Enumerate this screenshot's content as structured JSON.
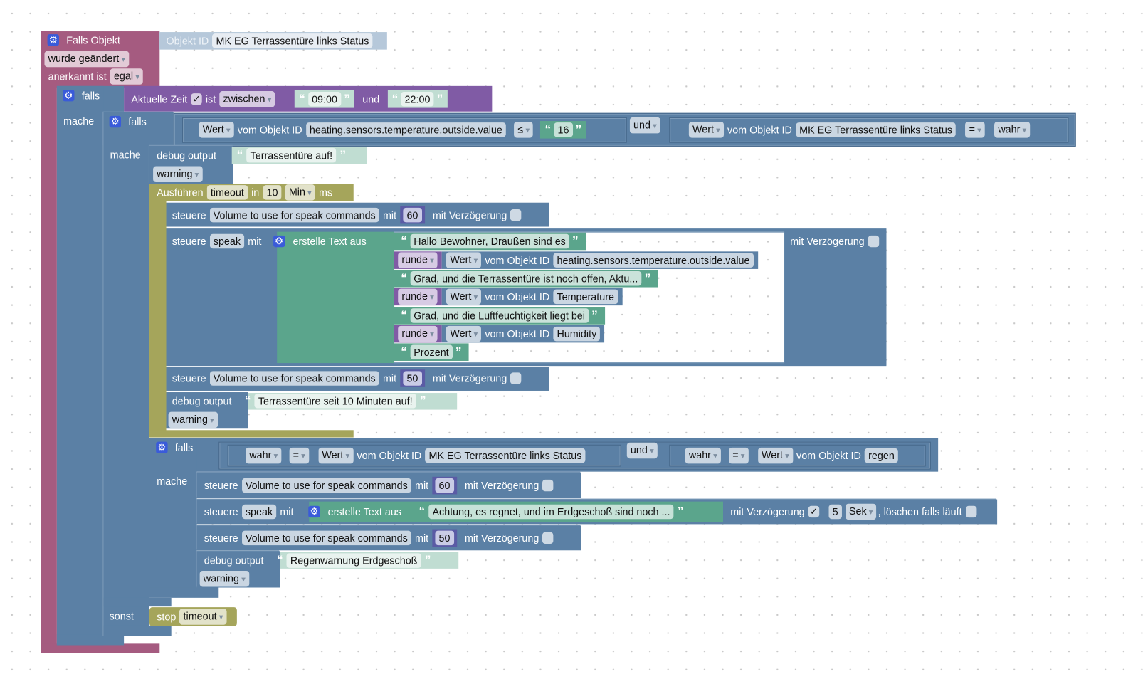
{
  "colors": {
    "trigger": "#a55b80",
    "logic": "#5b80a5",
    "time": "#805ba5",
    "timeout": "#a5a55b",
    "text": "#5ba58c",
    "string": "#c0ddd2",
    "number": "#5b5ba5"
  },
  "icons": {
    "gear": "gear-icon",
    "check": "✓"
  },
  "trigger": {
    "title": "Falls Objekt",
    "object_label": "Objekt ID",
    "object_id": "MK EG Terrassentüre links Status",
    "event": "wurde geändert",
    "ack_label": "anerkannt ist",
    "ack_value": "egal"
  },
  "if1": {
    "label": "falls",
    "do": "mache",
    "cond": {
      "label": "Aktuelle Zeit",
      "checked": "✓",
      "ist": "ist",
      "op": "zwischen",
      "from": "09:00",
      "and": "und",
      "to": "22:00"
    }
  },
  "if2": {
    "label": "falls",
    "do": "mache",
    "else": "sonst",
    "and": "und",
    "a": {
      "attr": "Wert",
      "of": "vom Objekt ID",
      "id": "heating.sensors.temperature.outside.value",
      "op": "≤",
      "value": "16"
    },
    "b": {
      "attr": "Wert",
      "of": "vom Objekt ID",
      "id": "MK EG Terrassentüre links Status",
      "op": "=",
      "value": "wahr"
    }
  },
  "debug1": {
    "label": "debug output",
    "text": "Terrassentüre auf!",
    "level": "warning"
  },
  "timeout": {
    "label": "Ausführen",
    "name": "timeout",
    "in": "in",
    "value": "10",
    "unit": "Min",
    "ms": "ms"
  },
  "vol1": {
    "label": "steuere",
    "target": "Volume to use for speak commands",
    "with": "mit",
    "value": "60",
    "delay": "mit Verzögerung"
  },
  "speak1": {
    "label": "steuere",
    "target": "speak",
    "with": "mit",
    "join": "erstelle Text aus",
    "delay": "mit Verzögerung",
    "parts": [
      {
        "type": "text",
        "value": "Hallo Bewohner, Draußen sind es"
      },
      {
        "type": "value",
        "round": "runde",
        "attr": "Wert",
        "of": "vom Objekt ID",
        "id": "heating.sensors.temperature.outside.value"
      },
      {
        "type": "text",
        "value": "Grad, und die Terrassentüre ist noch offen, Aktu..."
      },
      {
        "type": "value",
        "round": "runde",
        "attr": "Wert",
        "of": "vom Objekt ID",
        "id": "Temperature"
      },
      {
        "type": "text",
        "value": "Grad, und die Luftfeuchtigkeit liegt bei"
      },
      {
        "type": "value",
        "round": "runde",
        "attr": "Wert",
        "of": "vom Objekt ID",
        "id": "Humidity"
      },
      {
        "type": "text",
        "value": "Prozent"
      }
    ]
  },
  "vol2": {
    "label": "steuere",
    "target": "Volume to use for speak commands",
    "with": "mit",
    "value": "50",
    "delay": "mit Verzögerung"
  },
  "debug2": {
    "label": "debug output",
    "text": "Terrassentüre seit 10 Minuten auf!",
    "level": "warning"
  },
  "if3": {
    "label": "falls",
    "do": "mache",
    "and": "und",
    "a": {
      "left": "wahr",
      "op": "=",
      "attr": "Wert",
      "of": "vom Objekt ID",
      "id": "MK EG Terrassentüre links Status"
    },
    "b": {
      "left": "wahr",
      "op": "=",
      "attr": "Wert",
      "of": "vom Objekt ID",
      "id": "regen"
    }
  },
  "vol3": {
    "label": "steuere",
    "target": "Volume to use for speak commands",
    "with": "mit",
    "value": "60",
    "delay": "mit Verzögerung"
  },
  "speak2": {
    "label": "steuere",
    "target": "speak",
    "with": "mit",
    "join": "erstelle Text aus",
    "text": "Achtung, es regnet, und im Erdgeschoß sind noch ...",
    "delay": "mit Verzögerung",
    "delay_checked": "✓",
    "delay_value": "5",
    "delay_unit": "Sek",
    "clear": ", löschen falls läuft"
  },
  "vol4": {
    "label": "steuere",
    "target": "Volume to use for speak commands",
    "with": "mit",
    "value": "50",
    "delay": "mit Verzögerung"
  },
  "debug3": {
    "label": "debug output",
    "text": "Regenwarnung Erdgeschoß",
    "level": "warning"
  },
  "stop": {
    "label": "stop",
    "name": "timeout"
  }
}
